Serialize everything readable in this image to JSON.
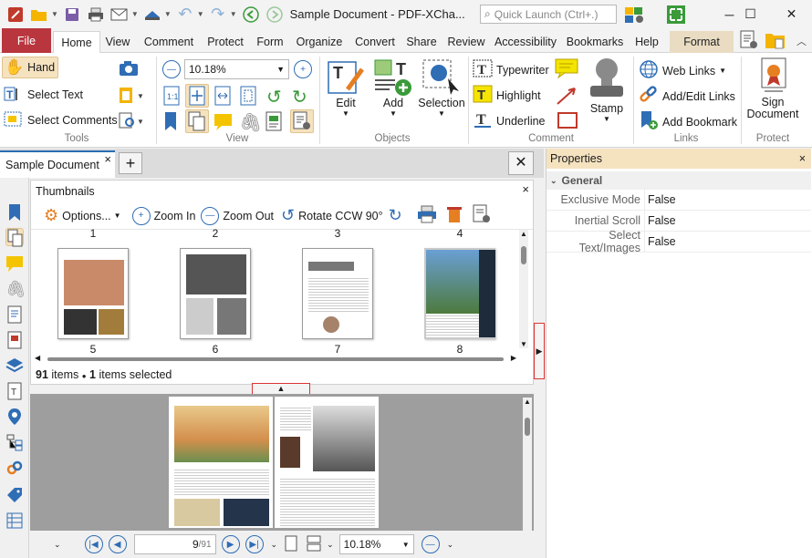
{
  "window": {
    "title": "Sample Document - PDF-XCha...",
    "search_placeholder": "Quick Launch (Ctrl+.)",
    "minimize": "─",
    "maximize": "☐",
    "close": "✕"
  },
  "ribbon_tabs": [
    "File",
    "Home",
    "View",
    "Comment",
    "Protect",
    "Form",
    "Organize",
    "Convert",
    "Share",
    "Review",
    "Accessibility",
    "Bookmarks",
    "Help",
    "Format"
  ],
  "tools": {
    "hand": "Hand",
    "select_text": "Select Text",
    "select_comments": "Select Comments",
    "group_label": "Tools"
  },
  "view": {
    "zoom_value": "10.18%",
    "group_label": "View"
  },
  "objects": {
    "edit": "Edit",
    "add": "Add",
    "selection": "Selection",
    "group_label": "Objects"
  },
  "comment": {
    "typewriter": "Typewriter",
    "highlight": "Highlight",
    "underline": "Underline",
    "stamp": "Stamp",
    "group_label": "Comment"
  },
  "links": {
    "web_links": "Web Links",
    "add_edit_links": "Add/Edit Links",
    "add_bookmark": "Add Bookmark",
    "group_label": "Links"
  },
  "protect": {
    "sign_document_1": "Sign",
    "sign_document_2": "Document",
    "group_label": "Protect"
  },
  "document_tab": {
    "name": "Sample Document",
    "close": "×",
    "new_tab": "+"
  },
  "thumbnails": {
    "title": "Thumbnails",
    "close": "×",
    "options": "Options...",
    "zoom_in": "Zoom In",
    "zoom_out": "Zoom Out",
    "rotate": "Rotate CCW 90°",
    "top_row_numbers": [
      "1",
      "2",
      "3",
      "4"
    ],
    "bottom_row_numbers": [
      "5",
      "6",
      "7",
      "8"
    ],
    "status_count": "91",
    "status_items": " items ",
    "status_bullet": "●",
    "status_selected_count": "1",
    "status_selected": " items selected"
  },
  "statusbar": {
    "page_current": "9",
    "page_total": "/91",
    "zoom": "10.18%"
  },
  "properties": {
    "title": "Properties",
    "close": "×",
    "section": "General",
    "rows": [
      {
        "name": "Exclusive Mode",
        "value": "False"
      },
      {
        "name": "Inertial Scroll",
        "value": "False"
      },
      {
        "name": "Select Text/Images",
        "value": "False"
      }
    ]
  }
}
